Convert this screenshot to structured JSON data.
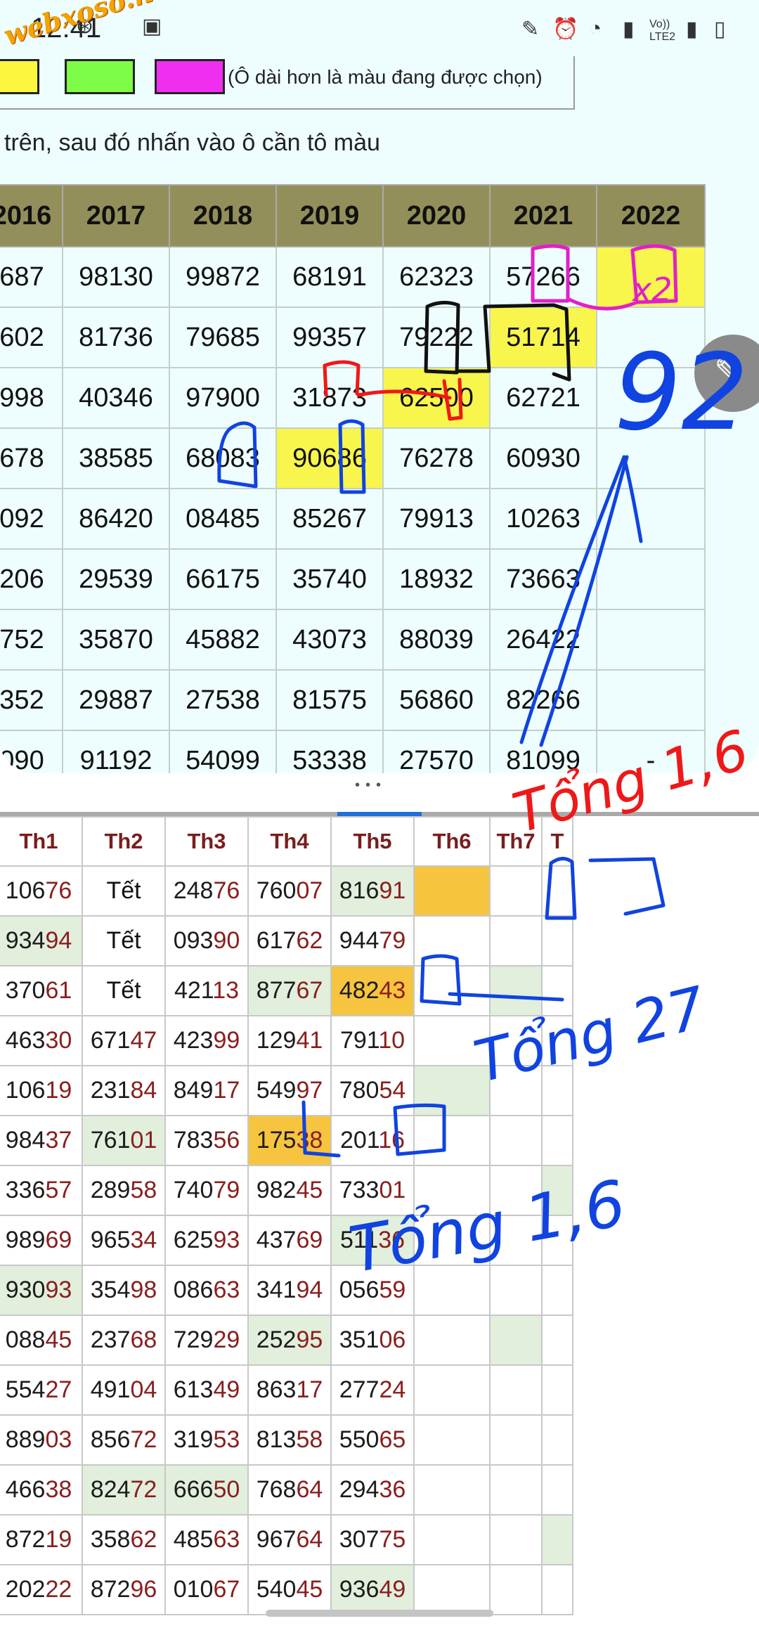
{
  "status_bar": {
    "time": "12:41",
    "icons": [
      "pen-icon",
      "alarm-icon",
      "wifi-icon",
      "signal-icon",
      "volte-icon",
      "battery-icon"
    ],
    "volte_label": "Vo)) LTE2"
  },
  "watermark": "webxoso.net",
  "palette": {
    "swatches": [
      "#fdf63f",
      "#7dfd47",
      "#f02ef0"
    ],
    "note": "(Ô dài hơn là màu đang được chọn)"
  },
  "instruction": "trên, sau đó nhấn vào ô cần tô màu",
  "year_table": {
    "headers": [
      "2016",
      "2017",
      "2018",
      "2019",
      "2020",
      "2021",
      "2022"
    ],
    "rows": [
      [
        "687",
        "98130",
        "99872",
        "68191",
        "62323",
        "57266",
        ""
      ],
      [
        "602",
        "81736",
        "79685",
        "99357",
        "79222",
        "51714",
        ""
      ],
      [
        "998",
        "40346",
        "97900",
        "31873",
        "62500",
        "62721",
        ""
      ],
      [
        "678",
        "38585",
        "68083",
        "90686",
        "76278",
        "60930",
        ""
      ],
      [
        "092",
        "86420",
        "08485",
        "85267",
        "79913",
        "10263",
        ""
      ],
      [
        "206",
        "29539",
        "66175",
        "35740",
        "18932",
        "73663",
        ""
      ],
      [
        "752",
        "35870",
        "45882",
        "43073",
        "88039",
        "26422",
        ""
      ],
      [
        "352",
        "29887",
        "27538",
        "81575",
        "56860",
        "82266",
        ""
      ],
      [
        "090",
        "91192",
        "54099",
        "53338",
        "27570",
        "81099",
        "-"
      ]
    ],
    "highlights": [
      [
        0,
        6
      ],
      [
        1,
        5
      ],
      [
        2,
        4
      ],
      [
        3,
        3
      ]
    ]
  },
  "week_table": {
    "headers": [
      "Th1",
      "Th2",
      "Th3",
      "Th4",
      "Th5",
      "Th6",
      "Th7",
      "T"
    ],
    "rows": [
      [
        "10676",
        "Tết",
        "24876",
        "76007",
        "81691",
        "",
        "",
        ""
      ],
      [
        "93494",
        "Tết",
        "09390",
        "61762",
        "94479",
        "",
        "",
        ""
      ],
      [
        "37061",
        "Tết",
        "42113",
        "87767",
        "48243",
        "",
        "",
        ""
      ],
      [
        "46330",
        "67147",
        "42399",
        "12941",
        "79110",
        "",
        "",
        ""
      ],
      [
        "10619",
        "23184",
        "84917",
        "54997",
        "78054",
        "",
        "",
        ""
      ],
      [
        "98437",
        "76101",
        "78356",
        "17538",
        "20116",
        "",
        "",
        ""
      ],
      [
        "33657",
        "28958",
        "74079",
        "98245",
        "73301",
        "",
        "",
        ""
      ],
      [
        "98969",
        "96534",
        "62593",
        "43769",
        "51136",
        "",
        "",
        ""
      ],
      [
        "93093",
        "35498",
        "08663",
        "34194",
        "05659",
        "",
        "",
        ""
      ],
      [
        "08845",
        "23768",
        "72929",
        "25295",
        "35106",
        "",
        "",
        ""
      ],
      [
        "55427",
        "49104",
        "61349",
        "86317",
        "27724",
        "",
        "",
        ""
      ],
      [
        "88903",
        "85672",
        "31953",
        "81358",
        "55065",
        "",
        "",
        ""
      ],
      [
        "46638",
        "82472",
        "66650",
        "76864",
        "29436",
        "",
        "",
        ""
      ],
      [
        "87219",
        "35862",
        "48563",
        "96764",
        "30775",
        "",
        "",
        ""
      ],
      [
        "20222",
        "87296",
        "01067",
        "54045",
        "93649",
        "",
        "",
        ""
      ]
    ],
    "green_cells": [
      [
        1,
        0
      ],
      [
        2,
        3
      ],
      [
        5,
        1
      ],
      [
        7,
        4
      ],
      [
        8,
        0
      ],
      [
        9,
        3
      ],
      [
        12,
        1
      ],
      [
        12,
        2
      ],
      [
        14,
        4
      ],
      [
        0,
        4
      ],
      [
        4,
        5
      ],
      [
        2,
        6
      ],
      [
        9,
        6
      ],
      [
        6,
        7
      ],
      [
        13,
        7
      ]
    ],
    "orange_cells": [
      [
        0,
        5
      ],
      [
        2,
        4
      ],
      [
        5,
        3
      ]
    ]
  },
  "annotations": {
    "x2": "x2",
    "big_number": "92",
    "tong_1": "Tổng 1,6",
    "tong_2": "Tổng 27",
    "tong_3": "Tổng 1,6"
  }
}
